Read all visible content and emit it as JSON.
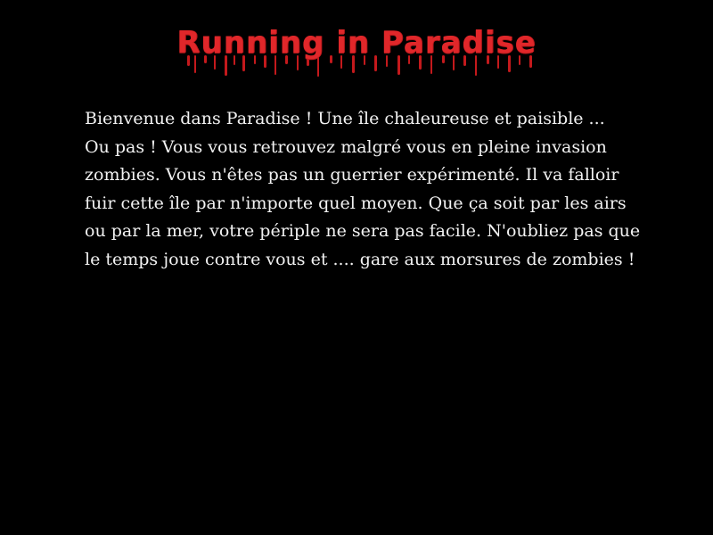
{
  "game": {
    "title": "Running in Paradise",
    "title_color": "#e0272a",
    "intro_lines": [
      "Bienvenue dans Paradise ! Une île chaleureuse et paisible ...",
      "Ou pas ! Vous vous retrouvez malgré vous en pleine invasion",
      "zombies. Vous n'êtes pas un guerrier expérimenté. Il va falloir",
      "fuir cette île par n'importe quel moyen. Que ça soit par les airs",
      "ou par la mer, votre périple ne sera pas facile. N'oubliez pas que",
      "le temps joue contre vous et .... gare aux morsures de zombies !"
    ],
    "background_color": "#000000",
    "text_color": "#f2f2f2"
  }
}
